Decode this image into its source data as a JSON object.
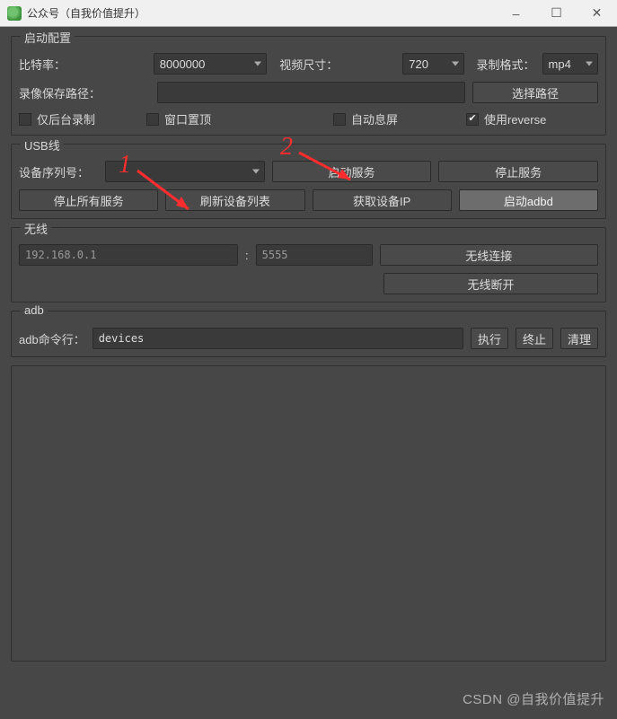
{
  "window": {
    "title": "公众号（自我价值提升）"
  },
  "startup": {
    "legend": "启动配置",
    "bitrate_label": "比特率：",
    "bitrate_value": "8000000",
    "videosize_label": "视频尺寸：",
    "videosize_value": "720",
    "recfmt_label": "录制格式：",
    "recfmt_value": "mp4",
    "savepath_label": "录像保存路径：",
    "choose_path": "选择路径",
    "chk_bgonly": "仅后台录制",
    "chk_topmost": "窗口置顶",
    "chk_autooff": "自动息屏",
    "chk_reverse": "使用reverse"
  },
  "usb": {
    "legend": "USB线",
    "serial_label": "设备序列号：",
    "start_service": "启动服务",
    "stop_service": "停止服务",
    "stop_all": "停止所有服务",
    "refresh": "刷新设备列表",
    "get_ip": "获取设备IP",
    "start_adbd": "启动adbd"
  },
  "wifi": {
    "legend": "无线",
    "ip_placeholder": "192.168.0.1",
    "colon": ":",
    "port_placeholder": "5555",
    "connect": "无线连接",
    "disconnect": "无线断开"
  },
  "adb": {
    "legend": "adb",
    "cmd_label": "adb命令行：",
    "cmd_value": "devices",
    "exec": "执行",
    "stop": "终止",
    "clear": "清理"
  },
  "anno": {
    "one": "1",
    "two": "2"
  },
  "watermark": "CSDN @自我价值提升"
}
